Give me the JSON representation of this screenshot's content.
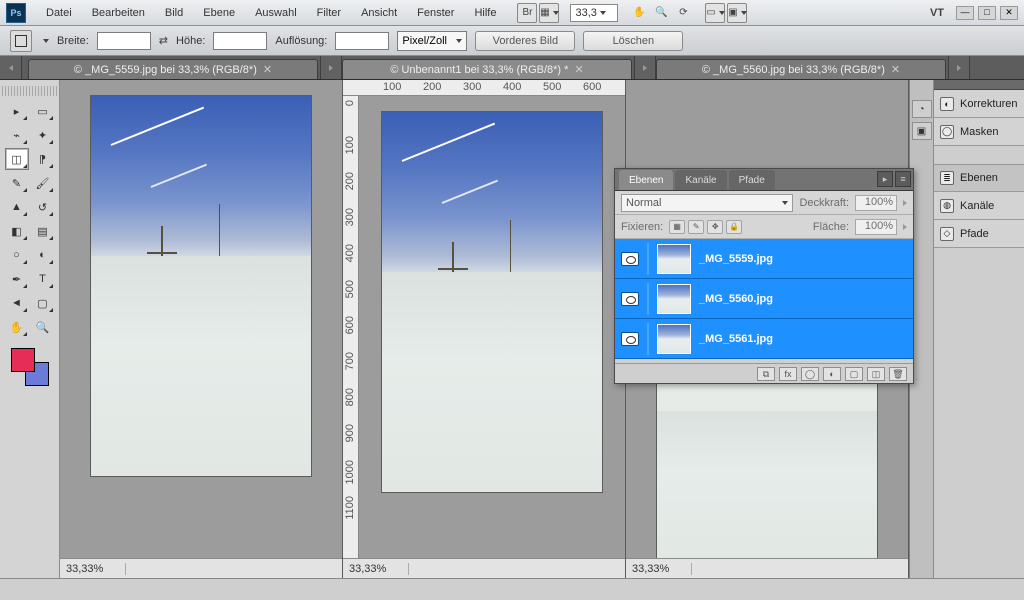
{
  "app": {
    "logo_text": "Ps",
    "workspace_label": "VT"
  },
  "menu": [
    "Datei",
    "Bearbeiten",
    "Bild",
    "Ebene",
    "Auswahl",
    "Filter",
    "Ansicht",
    "Fenster",
    "Hilfe"
  ],
  "top_tools": {
    "zoom_value": "33,3"
  },
  "options": {
    "width_label": "Breite:",
    "height_label": "Höhe:",
    "resolution_label": "Auflösung:",
    "resolution_unit": "Pixel/Zoll",
    "front_image_btn": "Vorderes Bild",
    "clear_btn": "Löschen"
  },
  "tabs": [
    {
      "title": "© _MG_5559.jpg bei 33,3% (RGB/8*)",
      "active": false
    },
    {
      "title": "© Unbenannt1 bei 33,3% (RGB/8*) *",
      "active": true
    },
    {
      "title": "© _MG_5560.jpg bei 33,3% (RGB/8*)",
      "active": false
    }
  ],
  "status": {
    "zoom": "33,33%"
  },
  "swatches": {
    "fg": "#e52d56",
    "bg": "#6a7bd8"
  },
  "right_panels": {
    "corrections": "Korrekturen",
    "masks": "Masken",
    "layers": "Ebenen",
    "channels": "Kanäle",
    "paths": "Pfade"
  },
  "layers_panel": {
    "tabs": [
      "Ebenen",
      "Kanäle",
      "Pfade"
    ],
    "active_tab": 0,
    "blend_mode": "Normal",
    "opacity_label": "Deckkraft:",
    "opacity_value": "100%",
    "lock_label": "Fixieren:",
    "fill_label": "Fläche:",
    "fill_value": "100%",
    "layers": [
      {
        "name": "_MG_5559.jpg"
      },
      {
        "name": "_MG_5560.jpg"
      },
      {
        "name": "_MG_5561.jpg"
      }
    ]
  },
  "ruler_h_ticks": [
    "100",
    "200",
    "300",
    "400",
    "500",
    "600"
  ],
  "ruler_v_ticks": [
    "0",
    "100",
    "200",
    "300",
    "400",
    "500",
    "600",
    "700",
    "800",
    "900",
    "1000",
    "1100"
  ]
}
